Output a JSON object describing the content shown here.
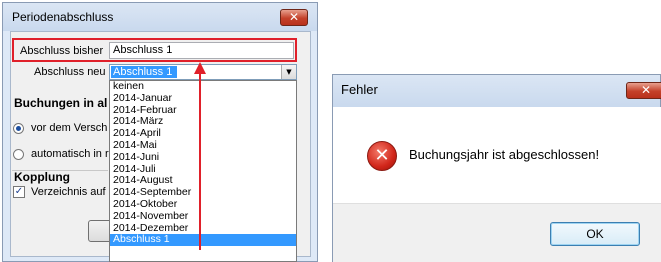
{
  "period_dialog": {
    "title": "Periodenabschluss",
    "close_glyph": "✕",
    "abschluss_bisher_label": "Abschluss bisher",
    "abschluss_bisher_value": "Abschluss 1",
    "abschluss_neu_label": "Abschluss neu",
    "abschluss_neu_selected": "Abschluss 1",
    "buchungen_heading": "Buchungen in al",
    "radio_vor_label": "vor dem Versch",
    "radio_auto_label": "automatisch in r",
    "kopplung_heading": "Kopplung",
    "verzeichnis_label": "Verzeichnis auf",
    "dropdown_options": [
      "keinen",
      "2014-Januar",
      "2014-Februar",
      "2014-März",
      "2014-April",
      "2014-Mai",
      "2014-Juni",
      "2014-Juli",
      "2014-August",
      "2014-September",
      "2014-Oktober",
      "2014-November",
      "2014-Dezember",
      "Abschluss 1"
    ],
    "highlighted_option": "Abschluss 1"
  },
  "error_dialog": {
    "title": "Fehler",
    "close_glyph": "✕",
    "icon": "error-x-icon",
    "message": "Buchungsjahr ist abgeschlossen!",
    "ok_label": "OK"
  },
  "colors": {
    "annotation_red": "#e0202a",
    "selection_blue": "#3399ff"
  }
}
